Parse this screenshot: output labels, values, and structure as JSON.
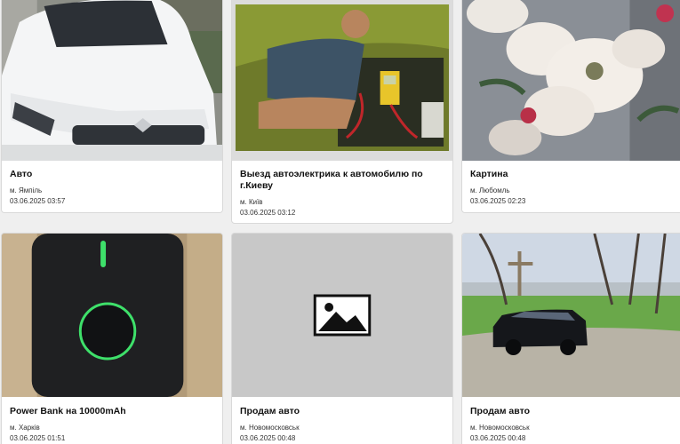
{
  "listings": [
    {
      "title": "Авто",
      "location": "м. Ямпіль",
      "date": "03.06.2025 03:57",
      "image_icon": "white-car-photo"
    },
    {
      "title": "Выезд автоэлектрика к автомобилю по г.Киеву",
      "location": "м. Київ",
      "date": "03.06.2025 03:12",
      "image_icon": "auto-electrician-photo"
    },
    {
      "title": "Картина",
      "location": "м. Любомль",
      "date": "03.06.2025 02:23",
      "image_icon": "flower-painting-photo"
    },
    {
      "title": "Power Bank на 10000mAh",
      "location": "м. Харків",
      "date": "03.06.2025 01:51",
      "image_icon": "power-bank-photo"
    },
    {
      "title": "Продам авто",
      "location": "м. Новомосковськ",
      "date": "03.06.2025 00:48",
      "image_icon": "image-placeholder-icon"
    },
    {
      "title": "Продам авто",
      "location": "м. Новомосковськ",
      "date": "03.06.2025 00:48",
      "image_icon": "black-suv-photo"
    }
  ]
}
